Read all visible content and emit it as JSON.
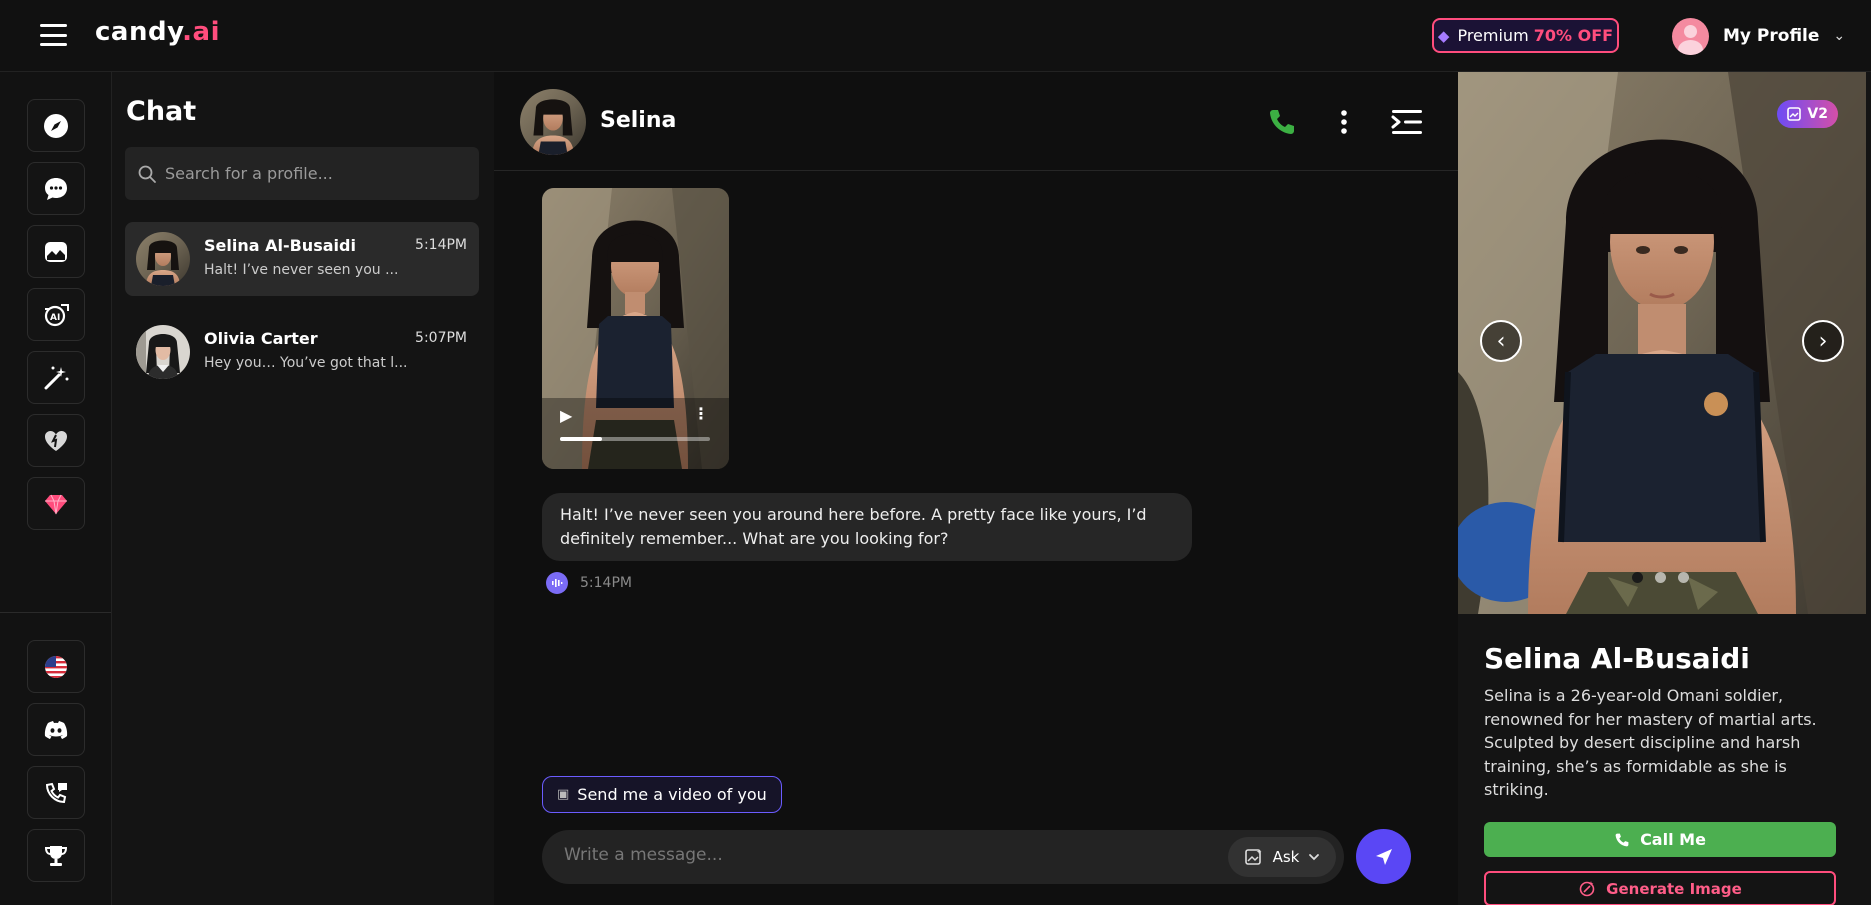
{
  "header": {
    "logo_main": "candy",
    "logo_accent": ".ai",
    "premium_label": "Premium",
    "premium_discount": "70% OFF",
    "profile_label": "My Profile"
  },
  "sidebar": {
    "items": [
      {
        "icon": "compass-icon"
      },
      {
        "icon": "chat-bubble-icon"
      },
      {
        "icon": "gallery-icon"
      },
      {
        "icon": "ai-face-icon"
      },
      {
        "icon": "magic-wand-icon"
      },
      {
        "icon": "heart-icon"
      },
      {
        "icon": "diamond-icon"
      }
    ],
    "bottom_items": [
      {
        "icon": "us-flag-icon"
      },
      {
        "icon": "discord-icon"
      },
      {
        "icon": "support-icon"
      },
      {
        "icon": "trophy-icon"
      }
    ]
  },
  "chatlist": {
    "title": "Chat",
    "search_placeholder": "Search for a profile...",
    "conversations": [
      {
        "name": "Selina Al-Busaidi",
        "time": "5:14PM",
        "preview": "Halt! I’ve never seen you ..."
      },
      {
        "name": "Olivia Carter",
        "time": "5:07PM",
        "preview": "Hey you… You’ve got that l..."
      }
    ]
  },
  "chat": {
    "name": "Selina",
    "video_progress": 0.28,
    "message_text": "Halt! I’ve never seen you around here before. A pretty face like yours, I’d definitely remember... What are you looking for?",
    "message_time": "5:14PM",
    "suggestion": "Send me a video of you",
    "input_placeholder": "Write a message...",
    "ask_label": "Ask"
  },
  "profile_panel": {
    "badge": "V2",
    "name": "Selina Al-Busaidi",
    "description": "Selina is a 26-year-old Omani soldier, renowned for her mastery of martial arts. Sculpted by desert discipline and harsh training, she’s as formidable as she is striking.",
    "call_label": "Call Me",
    "generate_label": "Generate Image"
  },
  "colors": {
    "accent_pink": "#ff4d7d",
    "send_purple": "#5a47f5",
    "call_green": "#4caf50"
  }
}
